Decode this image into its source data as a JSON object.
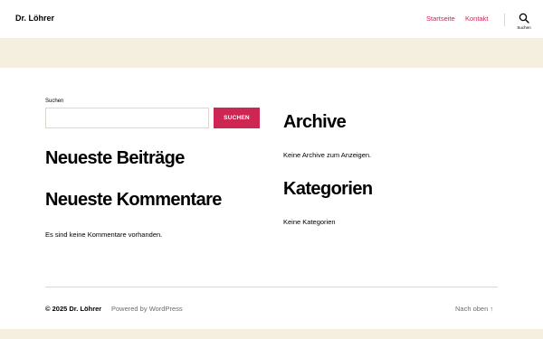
{
  "header": {
    "site_title": "Dr. Löhrer",
    "menu": [
      {
        "label": "Startseite"
      },
      {
        "label": "Kontakt"
      }
    ],
    "search_toggle_label": "Suchen",
    "accent_color": "#cd2653"
  },
  "search_widget": {
    "label": "Suchen",
    "value": "",
    "button_label": "SUCHEN"
  },
  "widgets": {
    "recent_posts_title": "Neueste Beiträge",
    "recent_comments_title": "Neueste Kommentare",
    "recent_comments_text": "Es sind keine Kommentare vorhanden.",
    "archive_title": "Archive",
    "archive_text": "Keine Archive zum Anzeigen.",
    "categories_title": "Kategorien",
    "categories_text": "Keine Kategorien"
  },
  "footer": {
    "copyright": "© 2025 Dr. Löhrer",
    "powered_by": "Powered by WordPress",
    "back_to_top": "Nach oben ↑"
  }
}
